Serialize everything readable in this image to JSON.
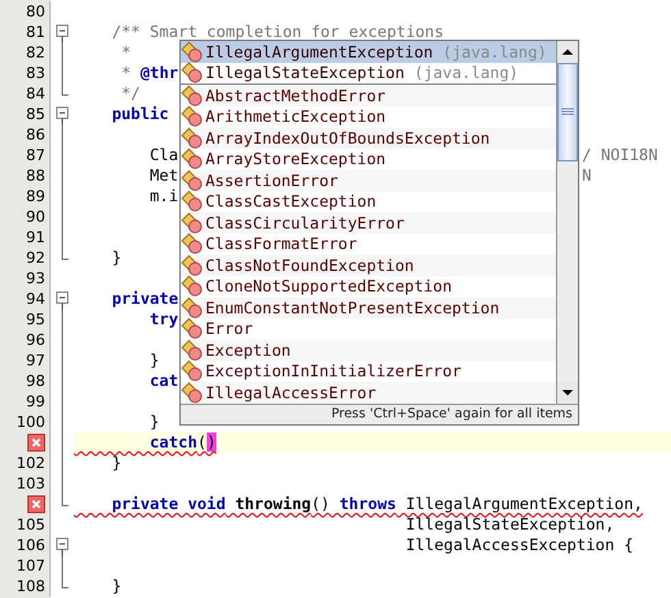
{
  "editor": {
    "lines": [
      {
        "num": "80"
      },
      {
        "num": "81",
        "fold": {
          "kind": "start"
        },
        "tokens": [
          {
            "kind": "comment",
            "text": "    /** Smart completion for exceptions"
          }
        ]
      },
      {
        "num": "82",
        "fold": {
          "kind": "line"
        },
        "tokens": [
          {
            "kind": "comment",
            "text": "     *"
          }
        ]
      },
      {
        "num": "83",
        "fold": {
          "kind": "line"
        },
        "tokens": [
          {
            "kind": "comment",
            "text": "     *"
          },
          {
            "kind": "tag",
            "text": " @thr"
          }
        ]
      },
      {
        "num": "84",
        "fold": {
          "kind": "end"
        },
        "tokens": [
          {
            "kind": "comment",
            "text": "     */"
          }
        ]
      },
      {
        "num": "85",
        "fold": {
          "kind": "start"
        },
        "tokens": [
          {
            "kind": "keyword",
            "text": "    public"
          }
        ]
      },
      {
        "num": "86",
        "fold": {
          "kind": "line"
        }
      },
      {
        "num": "87",
        "fold": {
          "kind": "line"
        },
        "tokens": [
          {
            "kind": "plain",
            "text": "        Cla"
          }
        ],
        "tail": "/ NOI18N"
      },
      {
        "num": "88",
        "fold": {
          "kind": "line"
        },
        "tokens": [
          {
            "kind": "plain",
            "text": "        Met"
          }
        ],
        "tail": "N"
      },
      {
        "num": "89",
        "fold": {
          "kind": "line"
        },
        "tokens": [
          {
            "kind": "plain",
            "text": "        m.i"
          }
        ]
      },
      {
        "num": "90",
        "fold": {
          "kind": "line"
        }
      },
      {
        "num": "91",
        "fold": {
          "kind": "line"
        }
      },
      {
        "num": "92",
        "fold": {
          "kind": "end"
        },
        "tokens": [
          {
            "kind": "plain",
            "text": "    }"
          }
        ]
      },
      {
        "num": "93"
      },
      {
        "num": "94",
        "fold": {
          "kind": "start"
        },
        "tokens": [
          {
            "kind": "keyword",
            "text": "    private"
          }
        ]
      },
      {
        "num": "95",
        "fold": {
          "kind": "line"
        },
        "tokens": [
          {
            "kind": "keyword",
            "text": "        try"
          }
        ]
      },
      {
        "num": "96",
        "fold": {
          "kind": "line"
        }
      },
      {
        "num": "97",
        "fold": {
          "kind": "line"
        },
        "tokens": [
          {
            "kind": "plain",
            "text": "        }"
          }
        ]
      },
      {
        "num": "98",
        "fold": {
          "kind": "line"
        },
        "tokens": [
          {
            "kind": "keyword",
            "text": "        cat"
          }
        ]
      },
      {
        "num": "99",
        "fold": {
          "kind": "line"
        }
      },
      {
        "num": "100",
        "fold": {
          "kind": "line"
        },
        "tokens": [
          {
            "kind": "plain",
            "text": "        }"
          }
        ]
      },
      {
        "error": true,
        "current": true,
        "fold": {
          "kind": "line"
        },
        "tokens": [
          {
            "kind": "keyword",
            "text": "        catch"
          },
          {
            "kind": "plain",
            "text": "("
          },
          {
            "kind": "match",
            "text": ")"
          }
        ]
      },
      {
        "num": "102",
        "fold": {
          "kind": "line"
        },
        "tokens": [
          {
            "kind": "plain",
            "text": "    }"
          }
        ]
      },
      {
        "num": "103",
        "fold": {
          "kind": "line"
        }
      },
      {
        "error": true,
        "fold": {
          "kind": "end"
        },
        "tokens": [
          {
            "kind": "keyword",
            "text": "    private void"
          },
          {
            "kind": "method",
            "text": " throwing"
          },
          {
            "kind": "plain",
            "text": "()"
          },
          {
            "kind": "keyword",
            "text": " throws"
          },
          {
            "kind": "plain",
            "text": " IllegalArgumentException,"
          }
        ]
      },
      {
        "num": "105",
        "tokens": [
          {
            "kind": "plain",
            "text": "                                   IllegalStateException,"
          }
        ]
      },
      {
        "num": "106",
        "fold": {
          "kind": "start"
        },
        "tokens": [
          {
            "kind": "plain",
            "text": "                                   IllegalAccessException {"
          }
        ]
      },
      {
        "num": "107",
        "fold": {
          "kind": "line"
        }
      },
      {
        "num": "108",
        "fold": {
          "kind": "end"
        },
        "tokens": [
          {
            "kind": "plain",
            "text": "    }"
          }
        ]
      }
    ]
  },
  "completion": {
    "smart_items": [
      {
        "name": "IllegalArgumentException",
        "package": "(java.lang)",
        "selected": true
      },
      {
        "name": "IllegalStateException",
        "package": "(java.lang)",
        "selected": false
      }
    ],
    "items": [
      {
        "name": "AbstractMethodError",
        "selected": false
      },
      {
        "name": "ArithmeticException",
        "selected": false
      },
      {
        "name": "ArrayIndexOutOfBoundsException",
        "selected": false
      },
      {
        "name": "ArrayStoreException",
        "selected": false
      },
      {
        "name": "AssertionError",
        "selected": false
      },
      {
        "name": "ClassCastException",
        "selected": false
      },
      {
        "name": "ClassCircularityError",
        "selected": false
      },
      {
        "name": "ClassFormatError",
        "selected": false
      },
      {
        "name": "ClassNotFoundException",
        "selected": false
      },
      {
        "name": "CloneNotSupportedException",
        "selected": false
      },
      {
        "name": "EnumConstantNotPresentException",
        "selected": false
      },
      {
        "name": "Error",
        "selected": false
      },
      {
        "name": "Exception",
        "selected": false
      },
      {
        "name": "ExceptionInInitializerError",
        "selected": false
      },
      {
        "name": "IllegalAccessError",
        "selected": false
      }
    ],
    "hint": "Press 'Ctrl+Space' again for all items"
  }
}
